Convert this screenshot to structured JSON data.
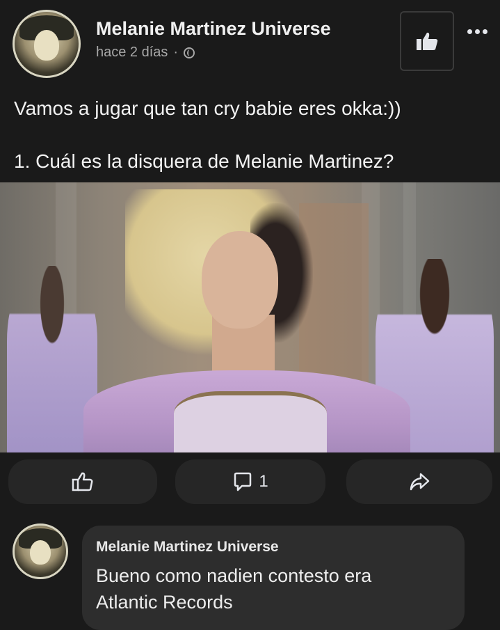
{
  "post": {
    "page_name": "Melanie Martinez Universe",
    "time": "hace 2 días",
    "separator": "·",
    "privacy_icon": "globe-icon",
    "text_line1": "Vamos a jugar que tan cry babie eres okka:))",
    "text_line2": "1. Cuál es la disquera de Melanie Martinez?"
  },
  "actions": {
    "like_icon": "thumbs-up-icon",
    "comment_icon": "comment-icon",
    "comment_count": "1",
    "share_icon": "share-icon"
  },
  "header_buttons": {
    "like_page_icon": "thumbs-up-icon",
    "more_icon": "more-options-icon"
  },
  "comment": {
    "author": "Melanie Martinez Universe",
    "text_line1": "Bueno como nadien contesto era",
    "text_line2": "Atlantic Records"
  }
}
